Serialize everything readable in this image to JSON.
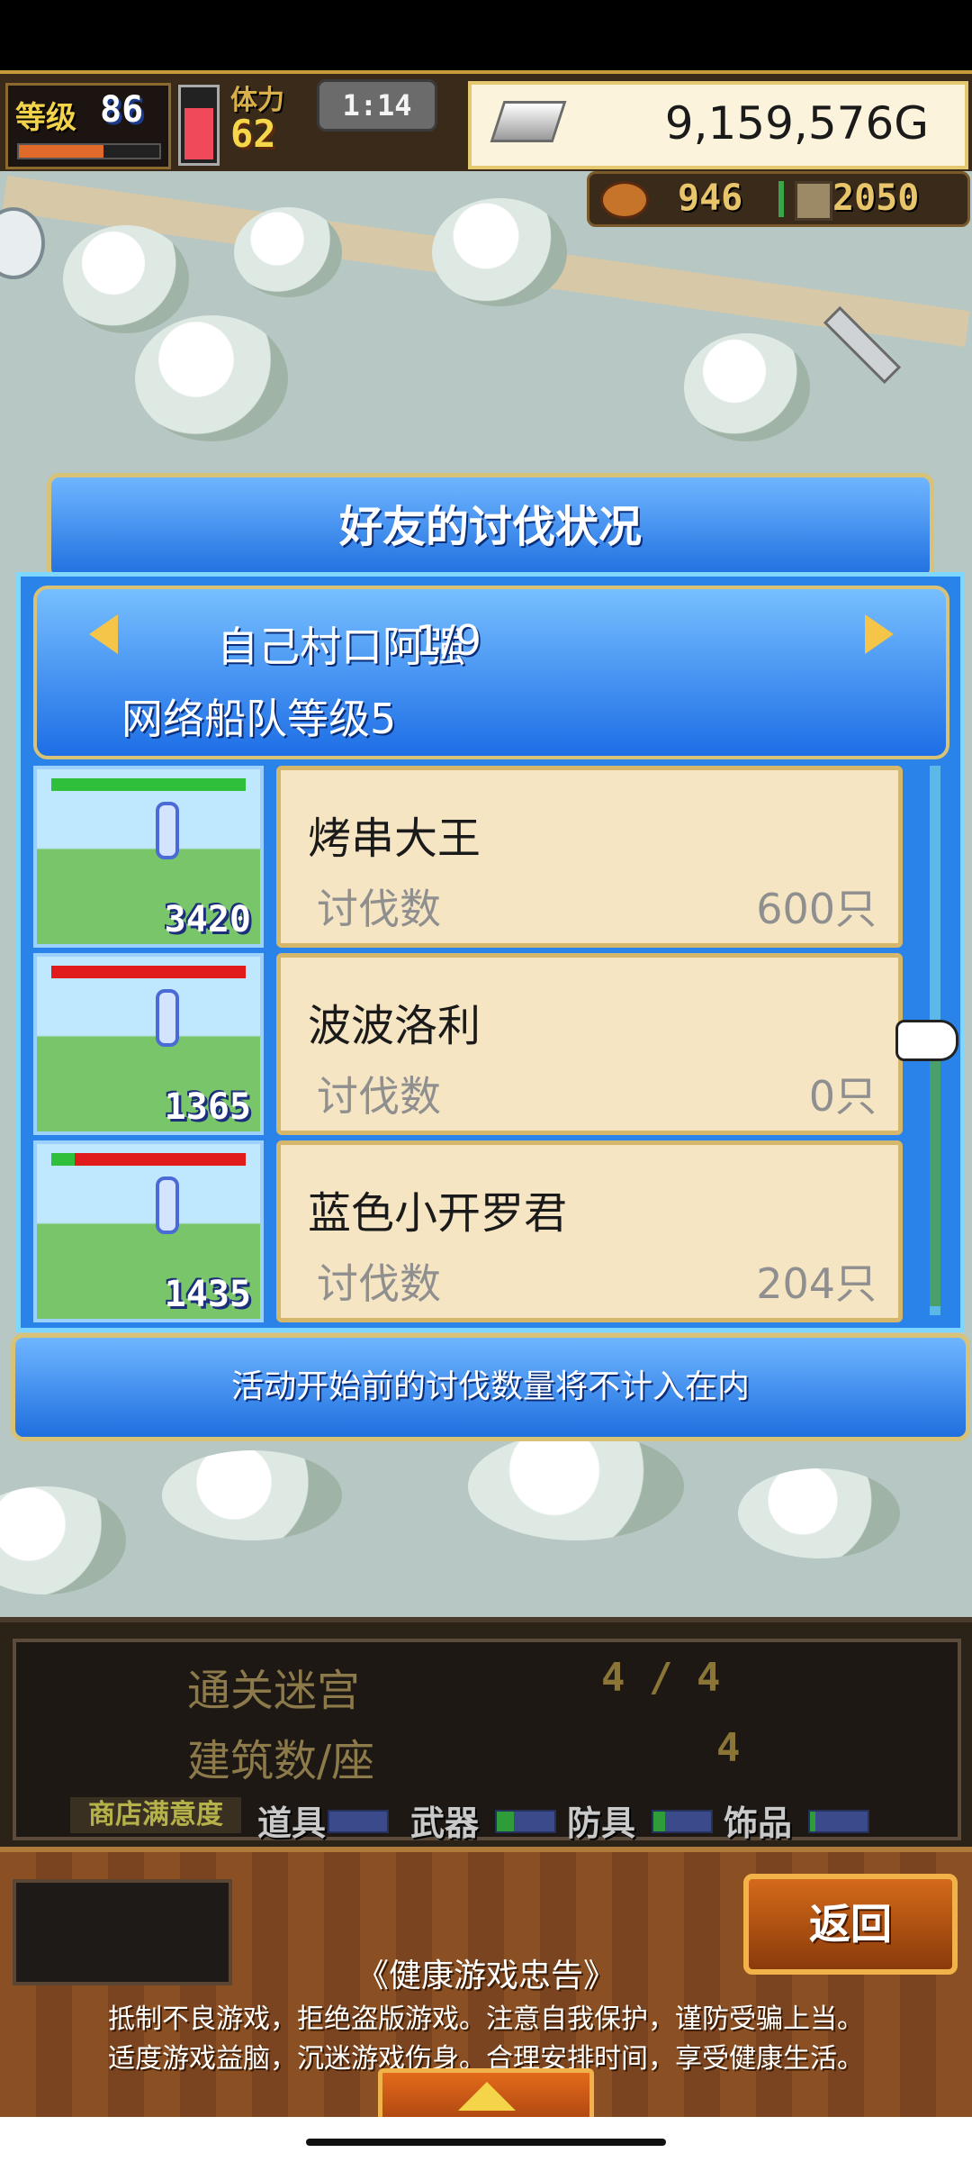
{
  "hud": {
    "level_label": "等级",
    "level_value": "86",
    "level_progress": 0.6,
    "stamina_label": "体力",
    "stamina_value": "62",
    "stamina_fill": 0.75,
    "timer": "1:14",
    "gold": "9,159,576G"
  },
  "resources": {
    "meat": "946",
    "ore": "2050"
  },
  "dialog": {
    "title": "好友的讨伐状况",
    "friend_name": "自己村口阿强",
    "friend_page": "1/9",
    "fleet_level": "网络船队等级5",
    "monsters": [
      {
        "name": "烤串大王",
        "label": "讨伐数",
        "count": "600只",
        "score": "3420",
        "hp": 1.0
      },
      {
        "name": "波波洛利",
        "label": "讨伐数",
        "count": "0只",
        "score": "1365",
        "hp": 0.0
      },
      {
        "name": "蓝色小开罗君",
        "label": "讨伐数",
        "count": "204只",
        "score": "1435",
        "hp": 0.12
      }
    ],
    "notice": "活动开始前的讨伐数量将不计入在内"
  },
  "stats": {
    "dungeon_label": "通关迷宫",
    "dungeon_value": "4 / 4",
    "building_label": "建筑数/座",
    "building_value": "4",
    "satisfaction_label": "商店满意度",
    "categories": [
      {
        "label": "道具",
        "fill": 0.0
      },
      {
        "label": "武器",
        "fill": 0.3
      },
      {
        "label": "防具",
        "fill": 0.2
      },
      {
        "label": "饰品",
        "fill": 0.1
      }
    ]
  },
  "footer": {
    "back_label": "返回",
    "health_title": "《健康游戏忠告》",
    "health_line1": "抵制不良游戏，拒绝盗版游戏。注意自我保护，谨防受骗上当。",
    "health_line2": "适度游戏益脑，沉迷游戏伤身。合理安排时间，享受健康生活。"
  }
}
